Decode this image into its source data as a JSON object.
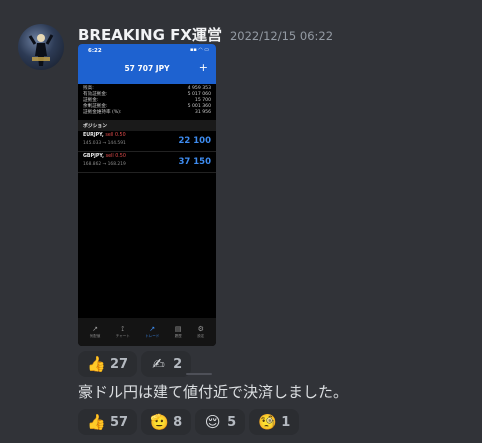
{
  "author": {
    "name": "BREAKING FX運営",
    "timestamp": "2022/12/15 06:22"
  },
  "attachment": {
    "status_time": "6:22",
    "status_icons": "▪▪ ◠ ▭",
    "balance": "57 707 JPY",
    "add_symbol": "+",
    "account": [
      {
        "label": "残高:",
        "value": "4 959 353"
      },
      {
        "label": "有効証拠金:",
        "value": "5 017 060"
      },
      {
        "label": "証拠金:",
        "value": "15 700"
      },
      {
        "label": "余剰証拠金:",
        "value": "5 001 360"
      },
      {
        "label": "証拠金維持率 (%):",
        "value": "31 956"
      }
    ],
    "positions_header": "ポジション",
    "positions": [
      {
        "symbol": "EURJPY,",
        "side": "sell 0.50",
        "prices": "145.033 → 144.591",
        "profit": "22 100"
      },
      {
        "symbol": "GBPJPY,",
        "side": "sell 0.50",
        "prices": "168.862 → 168.219",
        "profit": "37 150"
      }
    ],
    "tabs": [
      {
        "icon": "↗",
        "label": "気配値",
        "active": false
      },
      {
        "icon": "⟟",
        "label": "チャート",
        "active": false
      },
      {
        "icon": "↗",
        "label": "トレード",
        "active": true
      },
      {
        "icon": "▤",
        "label": "履歴",
        "active": false
      },
      {
        "icon": "⚙",
        "label": "設定",
        "active": false
      }
    ]
  },
  "reactions_first": [
    {
      "emoji": "👍",
      "icon": "thumbs-up-icon",
      "count": "27"
    },
    {
      "emoji": "✍",
      "icon": "writing-hand-icon",
      "count": "2"
    }
  ],
  "message_text": "豪ドル円は建て値付近で決済しました。",
  "reactions_second": [
    {
      "emoji": "👍",
      "icon": "thumbs-up-icon",
      "count": "57"
    },
    {
      "emoji": "🫡",
      "icon": "saluting-face-icon",
      "count": "8"
    },
    {
      "emoji": "😌",
      "icon": "relieved-face-icon",
      "count": "5"
    },
    {
      "emoji": "🧐",
      "icon": "monocle-face-icon",
      "count": "1"
    }
  ],
  "colors": {
    "background": "#313338",
    "reaction_bg": "#2b2d31",
    "phone_header": "#1e62d0",
    "profit_blue": "#3e8cf0",
    "sell_red": "#e14b4b"
  }
}
